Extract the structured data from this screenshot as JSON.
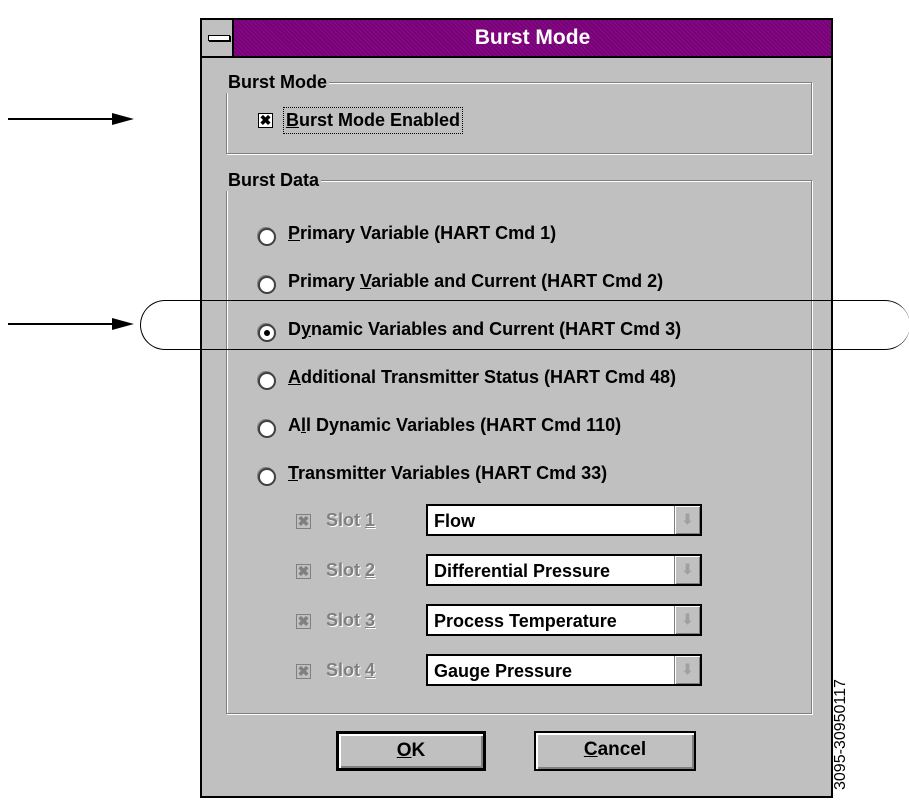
{
  "window": {
    "title": "Burst Mode",
    "system_menu_icon": "minus-bar-icon"
  },
  "burst_mode_group": {
    "label": "Burst Mode",
    "checkbox": {
      "label": "Burst Mode Enabled",
      "checked": true,
      "mark": "✖"
    }
  },
  "burst_data_group": {
    "label": "Burst Data",
    "options": [
      {
        "prefix": "",
        "accel": "P",
        "rest": "rimary Variable (HART Cmd 1)",
        "selected": false
      },
      {
        "prefix": "Primary ",
        "accel": "V",
        "rest": "ariable and Current (HART Cmd 2)",
        "selected": false
      },
      {
        "prefix": "D",
        "accel": "y",
        "rest": "namic Variables and Current (HART Cmd 3)",
        "selected": true
      },
      {
        "prefix": "",
        "accel": "A",
        "rest": "dditional Transmitter Status (HART Cmd 48)",
        "selected": false
      },
      {
        "prefix": "A",
        "accel": "l",
        "rest": "l Dynamic Variables (HART Cmd 110)",
        "selected": false
      },
      {
        "prefix": "",
        "accel": "T",
        "rest": "ransmitter Variables (HART Cmd 33)",
        "selected": false
      }
    ],
    "slots": [
      {
        "label": "Slot ",
        "num": "1",
        "value": "Flow",
        "checked": true
      },
      {
        "label": "Slot ",
        "num": "2",
        "value": "Differential Pressure",
        "checked": true
      },
      {
        "label": "Slot ",
        "num": "3",
        "value": "Process Temperature",
        "checked": true
      },
      {
        "label": "Slot ",
        "num": "4",
        "value": "Gauge Pressure",
        "checked": true
      }
    ],
    "slot_check_mark": "✖",
    "dropdown_arrow": "⬇"
  },
  "buttons": {
    "ok": {
      "accel": "O",
      "rest": "K"
    },
    "cancel": {
      "accel": "C",
      "rest": "ancel"
    }
  },
  "figure_number": "3095-30950117"
}
